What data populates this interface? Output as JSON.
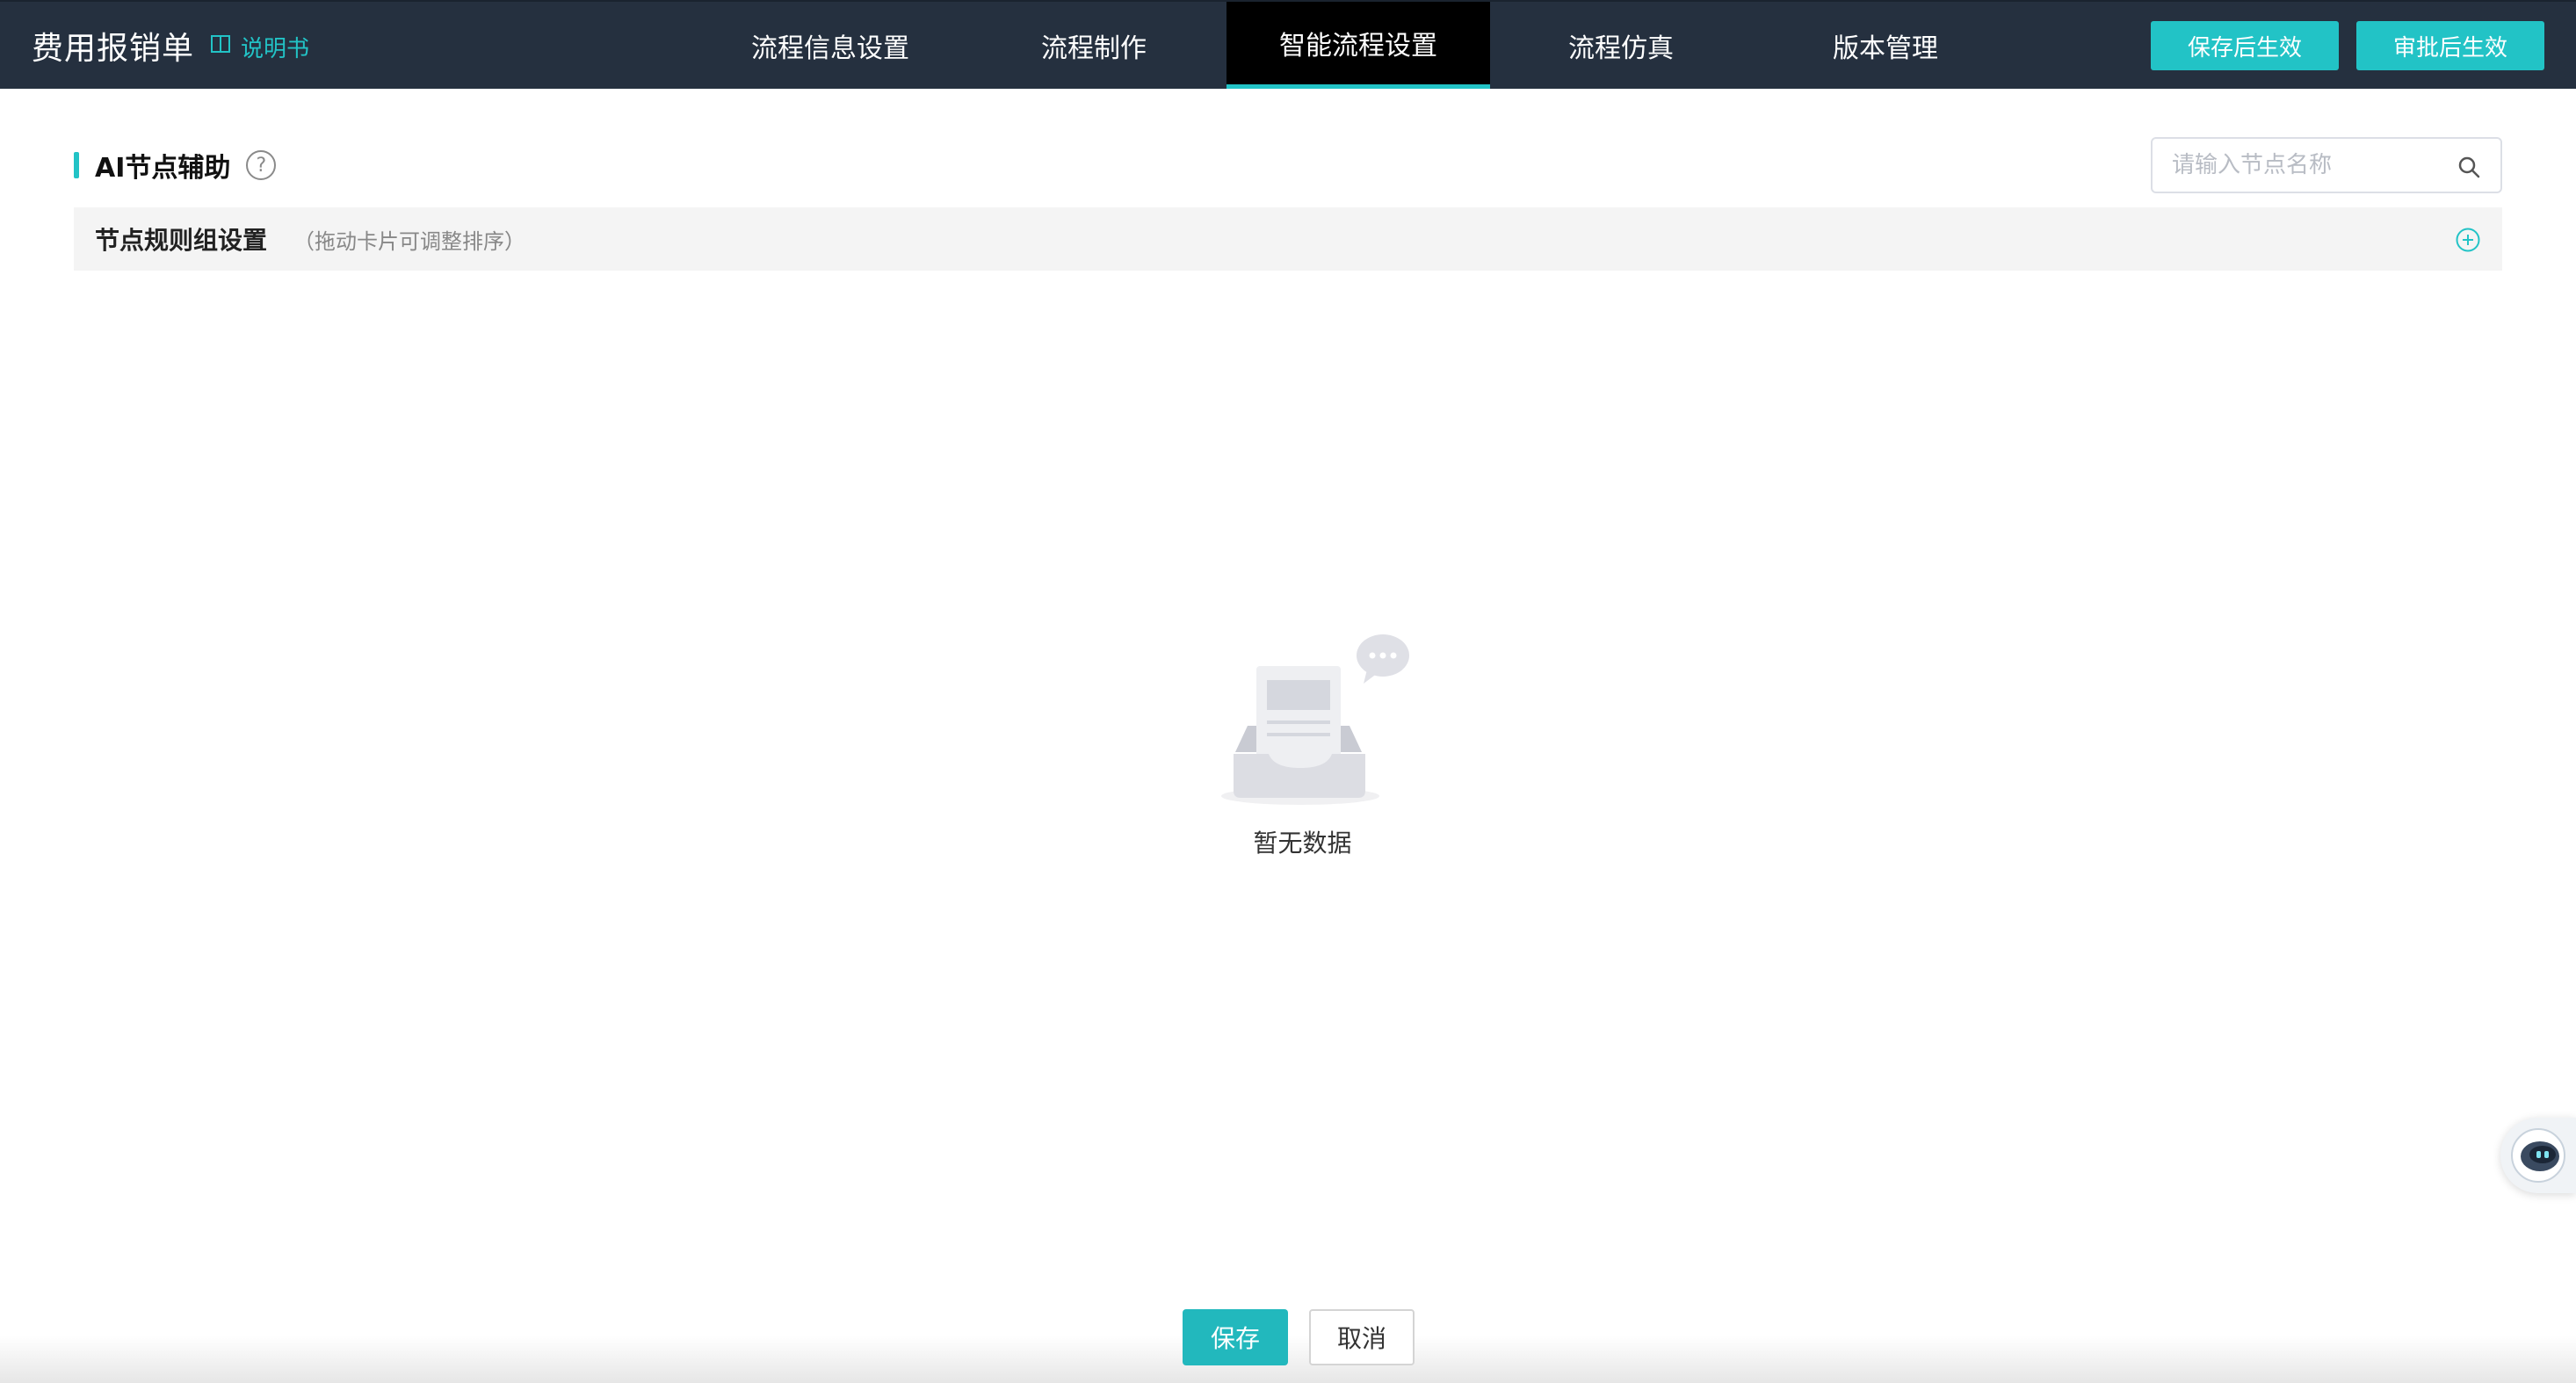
{
  "header": {
    "app_title": "费用报销单",
    "manual_link": "说明书",
    "tabs": [
      {
        "label": "流程信息设置",
        "active": false
      },
      {
        "label": "流程制作",
        "active": false
      },
      {
        "label": "智能流程设置",
        "active": true
      },
      {
        "label": "流程仿真",
        "active": false
      },
      {
        "label": "版本管理",
        "active": false
      }
    ],
    "save_effective_label": "保存后生效",
    "approve_effective_label": "审批后生效",
    "icons": {
      "manual": "book-icon"
    }
  },
  "section": {
    "title": "AI节点辅助",
    "help_icon": "question-icon",
    "search_placeholder": "请输入节点名称",
    "search_icon": "search-icon"
  },
  "rule_group": {
    "label": "节点规则组设置",
    "hint": "（拖动卡片可调整排序）",
    "add_icon": "plus-circle-icon"
  },
  "empty_state": {
    "text": "暂无数据",
    "illustration": "empty-inbox-icon"
  },
  "footer": {
    "save_label": "保存",
    "cancel_label": "取消"
  },
  "assistant": {
    "icon": "robot-assistant-icon"
  },
  "colors": {
    "topbar_bg": "#25303f",
    "accent": "#22c3c6",
    "active_tab_bg": "#000000"
  }
}
